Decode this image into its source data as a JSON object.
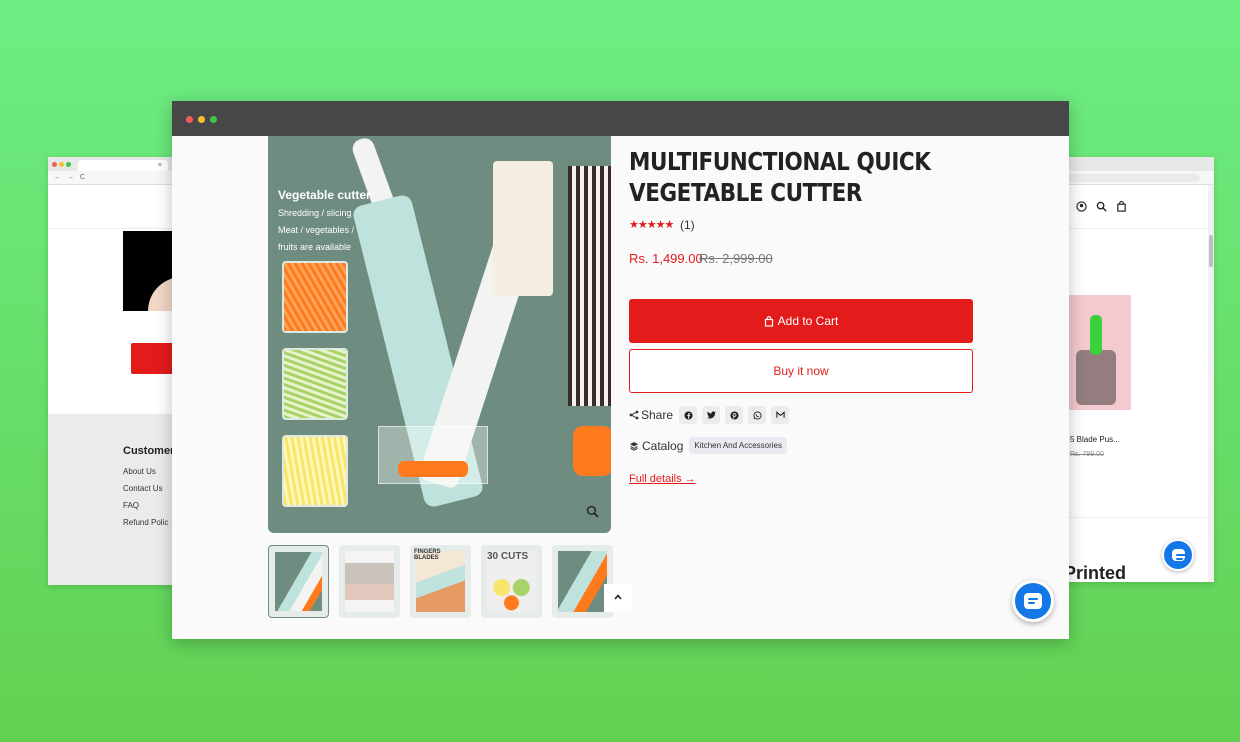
{
  "left_window": {
    "tab_close": "×",
    "nav": "← → C",
    "footer_title": "Customer",
    "footer_links": [
      "About Us",
      "Contact Us",
      "FAQ",
      "Refund Polic"
    ]
  },
  "right_window": {
    "icons": [
      "account-icon",
      "search-icon",
      "bag-icon"
    ],
    "product_name": "5 Blade Pus...",
    "product_old_price": "Rs. 799.00",
    "section_heading": "Printed"
  },
  "product": {
    "title": "MULTIFUNCTIONAL QUICK VEGETABLE CUTTER",
    "stars": "★★★★★",
    "rating_count": "(1)",
    "price": "Rs. 1,499.00",
    "compare_price": "Rs. 2,999.00",
    "add_to_cart": "Add to Cart",
    "buy_now": "Buy it now",
    "share_label": "Share",
    "share_icons": [
      "facebook-icon",
      "twitter-icon",
      "pinterest-icon",
      "whatsapp-icon",
      "email-icon"
    ],
    "catalog_label": "Catalog",
    "catalog_tag": "Kitchen And Accessories",
    "full_details": "Full details →"
  },
  "hero_image": {
    "title": "Vegetable cutter",
    "line1": "Shredding / slicing",
    "line2": "Meat / vegetables /",
    "line3": "fruits are available"
  },
  "thumbnails": [
    {
      "label": ""
    },
    {
      "label": ""
    },
    {
      "label": "FINGERS BLADES"
    },
    {
      "label": "30 CUTS"
    },
    {
      "label": ""
    }
  ],
  "colors": {
    "accent": "#e31b1b",
    "chat": "#1477e6",
    "background": "#66e070"
  }
}
